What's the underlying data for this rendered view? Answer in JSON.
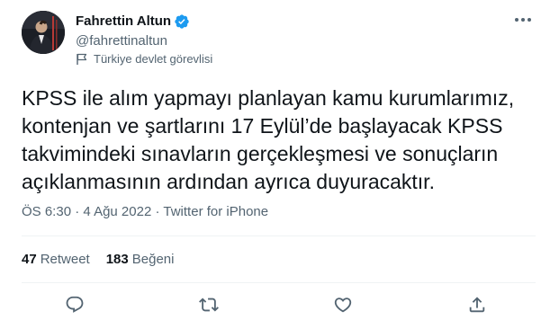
{
  "author": {
    "name": "Fahrettin Altun",
    "handle": "@fahrettinaltun",
    "label": "Türkiye devlet görevlisi"
  },
  "tweet": {
    "text": "KPSS ile alım yapmayı planlayan kamu kurumlarımız,\nkontenjan ve şartlarını 17 Eylül’de başlayacak KPSS\ntakvimindeki sınavların gerçekleşmesi ve sonuçların\naçıklanmasının ardından ayrıca duyuracaktır.",
    "time": "ÖS 6:30",
    "separator": "·",
    "date": "4 Ağu 2022",
    "source": "Twitter for iPhone"
  },
  "stats": {
    "retweets_count": "47",
    "retweets_label": "Retweet",
    "likes_count": "183",
    "likes_label": "Beğeni"
  },
  "colors": {
    "text": "#0f1419",
    "secondary": "#536471",
    "verified": "#1d9bf0",
    "divider": "#eff3f4"
  },
  "icons": [
    "verified-badge-icon",
    "more-options-icon",
    "flag-icon",
    "reply-icon",
    "retweet-icon",
    "like-icon",
    "share-icon"
  ]
}
